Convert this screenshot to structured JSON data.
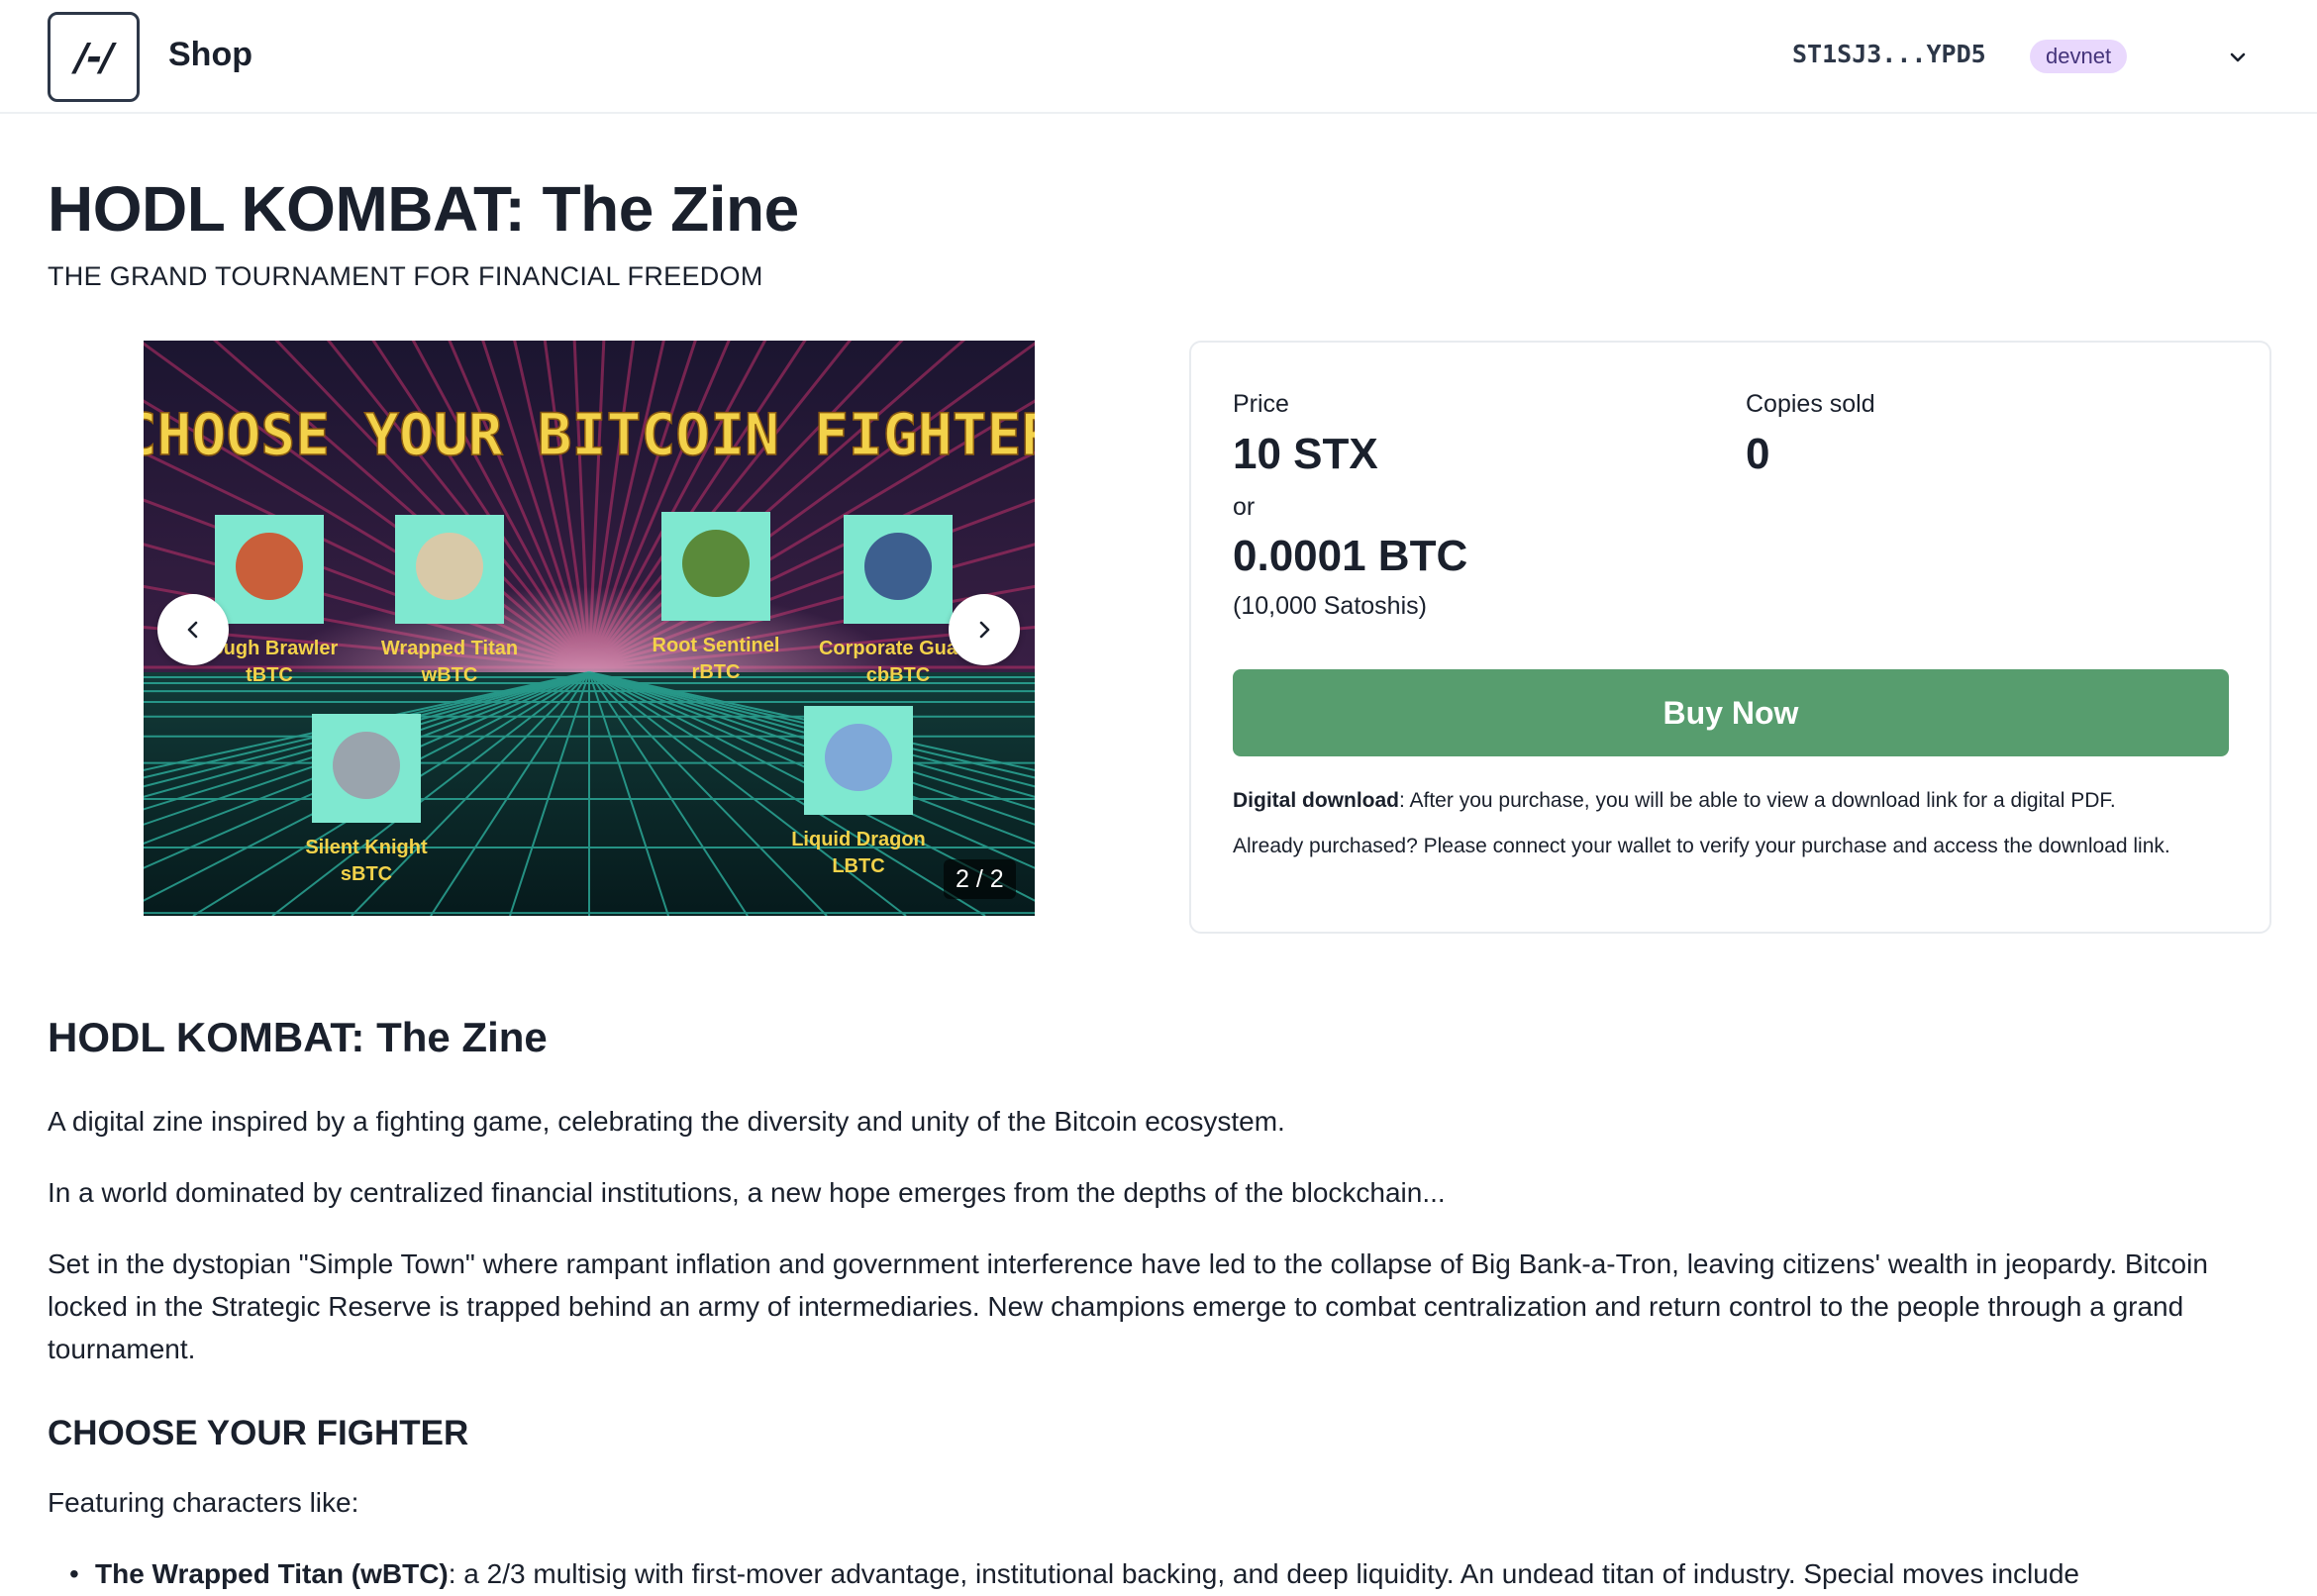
{
  "header": {
    "logo_text": "/-/",
    "brand": "Shop",
    "wallet": "ST1SJ3...YPD5",
    "network": "devnet"
  },
  "product": {
    "title": "HODL KOMBAT: The Zine",
    "subtitle": "THE GRAND TOURNAMENT FOR FINANCIAL FREEDOM"
  },
  "carousel": {
    "counter": "2 / 2",
    "banner": "CHOOSE YOUR BITCOIN FIGHTER",
    "fighters": [
      {
        "name": "Tough Brawler",
        "token": "tBTC"
      },
      {
        "name": "Wrapped Titan",
        "token": "wBTC"
      },
      {
        "name": "Root Sentinel",
        "token": "rBTC"
      },
      {
        "name": "Corporate Guard",
        "token": "cbBTC"
      },
      {
        "name": "Silent Knight",
        "token": "sBTC"
      },
      {
        "name": "Liquid Dragon",
        "token": "LBTC"
      }
    ]
  },
  "pricing": {
    "price_label": "Price",
    "price_stx": "10 STX",
    "or_label": "or",
    "price_btc": "0.0001 BTC",
    "price_sats": "(10,000 Satoshis)",
    "sold_label": "Copies sold",
    "sold_count": "0",
    "buy_label": "Buy Now",
    "download_bold": "Digital download",
    "download_text": ": After you purchase, you will be able to view a download link for a digital PDF.",
    "already_text": "Already purchased? Please connect your wallet to verify your purchase and access the download link."
  },
  "description": {
    "heading": "HODL KOMBAT: The Zine",
    "p1": "A digital zine inspired by a fighting game, celebrating the diversity and unity of the Bitcoin ecosystem.",
    "p2": "In a world dominated by centralized financial institutions, a new hope emerges from the depths of the blockchain...",
    "p3": "Set in the dystopian \"Simple Town\" where rampant inflation and government interference have led to the collapse of Big Bank-a-Tron, leaving citizens' wealth in jeopardy. Bitcoin locked in the Strategic Reserve is trapped behind an army of intermediaries. New champions emerge to combat centralization and return control to the people through a grand tournament.",
    "subheading": "CHOOSE YOUR FIGHTER",
    "featuring": "Featuring characters like:",
    "bullet1_bold": "The Wrapped Titan (wBTC)",
    "bullet1_text": ": a 2/3 multisig with first-mover advantage, institutional backing, and deep liquidity. An undead titan of industry. Special moves include"
  }
}
